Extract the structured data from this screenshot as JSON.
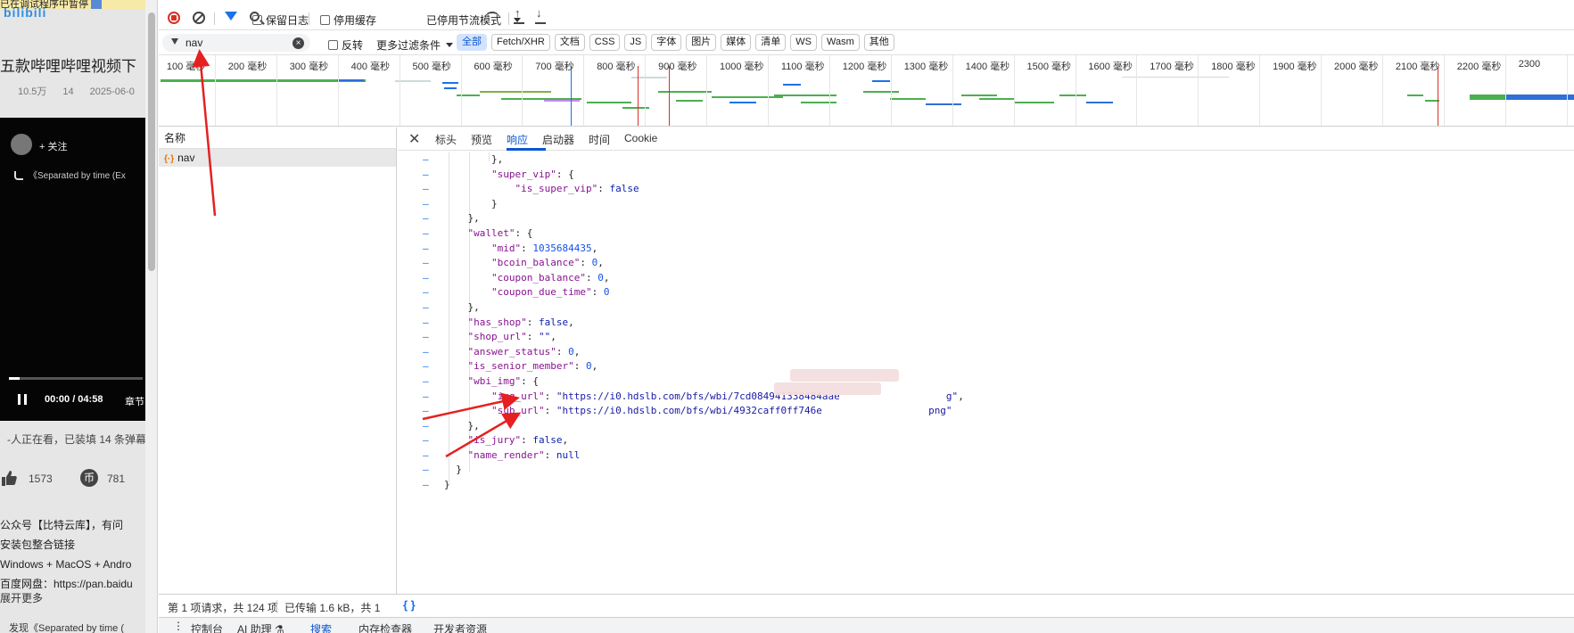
{
  "page": {
    "debug_banner": "已在调试程序中暂停",
    "logo": "bilibili",
    "video_title": "五款哔哩哔哩视频下",
    "views": "10.5万",
    "danmaku": "14",
    "date": "2025-06-0",
    "follow": "+ 关注",
    "song": "《Separated by time (Ex",
    "time_display": "00:00 / 04:58",
    "chapter": "章节",
    "watching": "-人正在看，已装填 14 条弹幕",
    "like_count": "1573",
    "coin_count": "781",
    "desc_lines": [
      "公众号【比特云库】，有问",
      "安装包整合链接",
      "Windows + MacOS + Andro",
      "百度网盘：https://pan.baidu"
    ],
    "expand": "展开更多",
    "recommend": "发现《Separated by time ("
  },
  "toolbar": {
    "preserve_log": "保留日志",
    "disable_cache": "停用缓存",
    "throttle": "已停用节流模式",
    "filter_value": "nav",
    "invert": "反转",
    "more_filters": "更多过滤条件",
    "types": [
      "全部",
      "Fetch/XHR",
      "文档",
      "CSS",
      "JS",
      "字体",
      "图片",
      "媒体",
      "清单",
      "WS",
      "Wasm",
      "其他"
    ]
  },
  "timeline": {
    "ticks": [
      "100 毫秒",
      "200 毫秒",
      "300 毫秒",
      "400 毫秒",
      "500 毫秒",
      "600 毫秒",
      "700 毫秒",
      "800 毫秒",
      "900 毫秒",
      "1000 毫秒",
      "1100 毫秒",
      "1200 毫秒",
      "1300 毫秒",
      "1400 毫秒",
      "1500 毫秒",
      "1600 毫秒",
      "1700 毫秒",
      "1800 毫秒",
      "1900 毫秒",
      "2000 毫秒",
      "2100 毫秒",
      "2200 毫秒",
      "2300"
    ]
  },
  "requests": {
    "header": "名称",
    "rows": [
      "nav"
    ]
  },
  "detail_tabs": [
    "标头",
    "预览",
    "响应",
    "启动器",
    "时间",
    "Cookie"
  ],
  "response_lines": [
    "        },",
    "        \"super_vip\": {",
    "            \"is_super_vip\": false",
    "        }",
    "    },",
    "    \"wallet\": {",
    "        \"mid\": 1035684435,",
    "        \"bcoin_balance\": 0,",
    "        \"coupon_balance\": 0,",
    "        \"coupon_due_time\": 0",
    "    },",
    "    \"has_shop\": false,",
    "    \"shop_url\": \"\",",
    "    \"answer_status\": 0,",
    "    \"is_senior_member\": 0,",
    "    \"wbi_img\": {",
    "        \"img_url\": \"https://i0.hdslb.com/bfs/wbi/7cd084941338484aae                  g\",",
    "        \"sub_url\": \"https://i0.hdslb.com/bfs/wbi/4932caff0ff746e                  png\"",
    "    },",
    "    \"is_jury\": false,",
    "    \"name_render\": null",
    "  }",
    "}"
  ],
  "status": {
    "requests": "第 1 项请求，共 124 项",
    "transferred": "已传输 1.6 kB，共 1",
    "format_icon": "{ }"
  },
  "drawer": {
    "tabs": [
      "控制台",
      "AI 助理 ⚗",
      "搜索",
      "内存检查器",
      "开发者资源"
    ],
    "active": "搜索"
  }
}
